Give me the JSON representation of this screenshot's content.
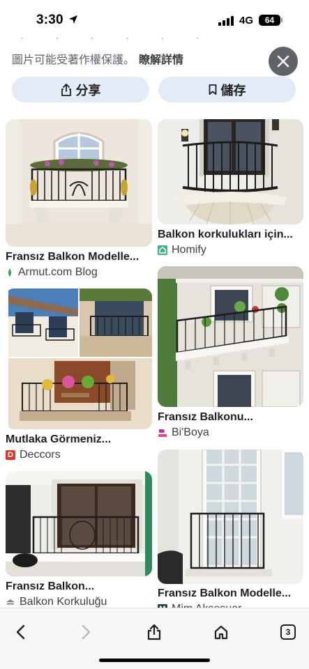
{
  "status": {
    "time": "3:30",
    "network": "4G",
    "battery": "64"
  },
  "notice": {
    "copyright_text": "圖片可能受著作權保護。",
    "learn_more": "瞭解詳情"
  },
  "actions": {
    "share_label": "分享",
    "save_label": "儲存"
  },
  "results": [
    {
      "title": "Fransız Balkon Modelle...",
      "source": "Armut.com Blog",
      "favicon": "armut-icon"
    },
    {
      "title": "Balkon korkulukları için...",
      "source": "Homify",
      "favicon": "homify-icon"
    },
    {
      "title": "Mutlaka Görmeniz...",
      "source": "Deccors",
      "favicon": "deccors-icon"
    },
    {
      "title": "Fransız Balkonu...",
      "source": "Bi'Boya",
      "favicon": "biboya-icon"
    },
    {
      "title": "Fransız Balkon...",
      "source": "Balkon Korkuluğu",
      "favicon": "balkon-korkulugu-icon"
    },
    {
      "title": "Fransız Balkon Modelle...",
      "source": "Mim Aksesuar",
      "favicon": "mim-aksesuar-icon"
    }
  ],
  "bottom_nav": {
    "tab_count": "3"
  }
}
